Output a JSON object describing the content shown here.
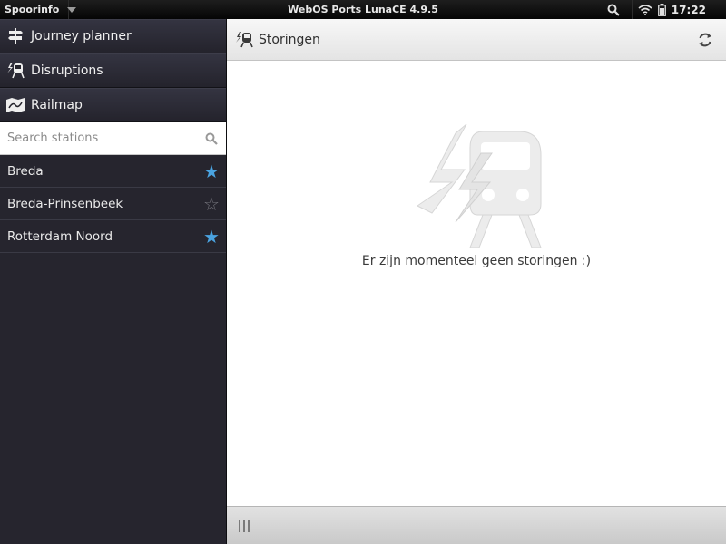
{
  "statusbar": {
    "app_name": "Spoorinfo",
    "title": "WebOS Ports LunaCE 4.9.5",
    "clock": "17:22"
  },
  "nav": {
    "items": [
      {
        "label": "Journey planner",
        "icon": "signpost-icon"
      },
      {
        "label": "Disruptions",
        "icon": "train-disruption-icon"
      },
      {
        "label": "Railmap",
        "icon": "map-icon"
      }
    ]
  },
  "search": {
    "placeholder": "Search stations",
    "value": ""
  },
  "stations": [
    {
      "name": "Breda",
      "favorite": true
    },
    {
      "name": "Breda-Prinsenbeek",
      "favorite": false
    },
    {
      "name": "Rotterdam Noord",
      "favorite": true
    }
  ],
  "header": {
    "title": "Storingen"
  },
  "content": {
    "empty_message": "Er zijn momenteel geen storingen :)"
  },
  "colors": {
    "favorite_star": "#4aa3e0",
    "sidebar_bg": "#26252e"
  }
}
